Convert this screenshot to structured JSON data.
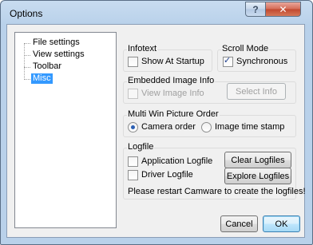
{
  "window": {
    "title": "Options"
  },
  "titlebar": {
    "help_label": "?",
    "close_label": "✕"
  },
  "tree": {
    "items": [
      {
        "label": "File settings"
      },
      {
        "label": "View settings"
      },
      {
        "label": "Toolbar"
      },
      {
        "label": "Misc",
        "selected": true
      }
    ]
  },
  "infotext": {
    "title": "Infotext",
    "show_at_startup": {
      "label": "Show At Startup",
      "checked": false
    }
  },
  "scroll_mode": {
    "title": "Scroll Mode",
    "synchronous": {
      "label": "Synchronous",
      "checked": true
    }
  },
  "embedded_image_info": {
    "title": "Embedded Image Info",
    "view_image_info": {
      "label": "View Image Info",
      "checked": false,
      "enabled": false
    },
    "select_info_button": "Select Info"
  },
  "picture_order": {
    "title": "Multi Win Picture Order",
    "options": [
      {
        "label": "Camera order",
        "selected": true
      },
      {
        "label": "Image time stamp",
        "selected": false
      }
    ]
  },
  "logfile": {
    "title": "Logfile",
    "application_logfile": {
      "label": "Application Logfile",
      "checked": false
    },
    "driver_logfile": {
      "label": "Driver Logfile",
      "checked": false
    },
    "clear_button": "Clear Logfiles",
    "explore_button": "Explore Logfiles",
    "note": "Please restart Camware to create the logfiles!"
  },
  "footer": {
    "cancel_label": "Cancel",
    "ok_label": "OK"
  },
  "colors": {
    "selection": "#3399ff",
    "titlebar": "#b9d1ea",
    "close_button": "#c1472e",
    "dialog_bg": "#f0f0f0"
  }
}
